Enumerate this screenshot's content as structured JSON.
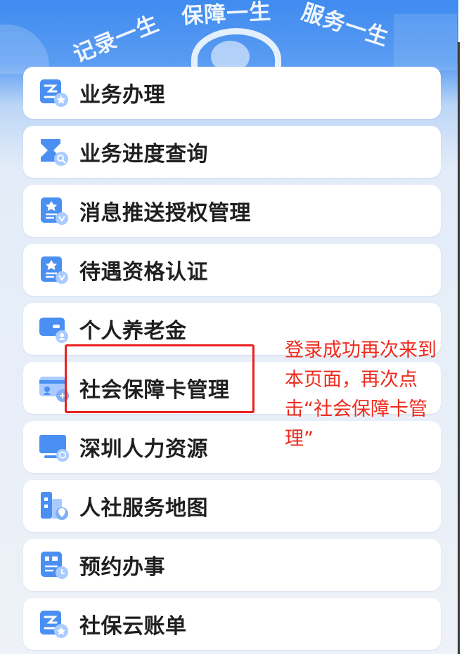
{
  "banner": {
    "slogans": [
      "记录一生",
      "保障一生",
      "服务一生"
    ]
  },
  "menu": {
    "items": [
      {
        "label": "业务办理",
        "icon": "business-handling-icon"
      },
      {
        "label": "业务进度查询",
        "icon": "progress-query-icon"
      },
      {
        "label": "消息推送授权管理",
        "icon": "message-authorization-icon"
      },
      {
        "label": "待遇资格认证",
        "icon": "qualification-certification-icon"
      },
      {
        "label": "个人养老金",
        "icon": "pension-card-icon"
      },
      {
        "label": "社会保障卡管理",
        "icon": "social-security-card-icon"
      },
      {
        "label": "深圳人力资源",
        "icon": "monitor-icon"
      },
      {
        "label": "人社服务地图",
        "icon": "service-map-icon"
      },
      {
        "label": "预约办事",
        "icon": "appointment-icon"
      },
      {
        "label": "社保云账单",
        "icon": "cloud-bill-icon"
      }
    ]
  },
  "annotation": {
    "note": "登录成功再次来到本页面，再次点击“社会保障卡管理”",
    "color": "#ee2a1d"
  },
  "colors": {
    "accent": "#3f8bf0",
    "icon_light": "#a9cbff",
    "icon_main": "#4a8ff2"
  }
}
